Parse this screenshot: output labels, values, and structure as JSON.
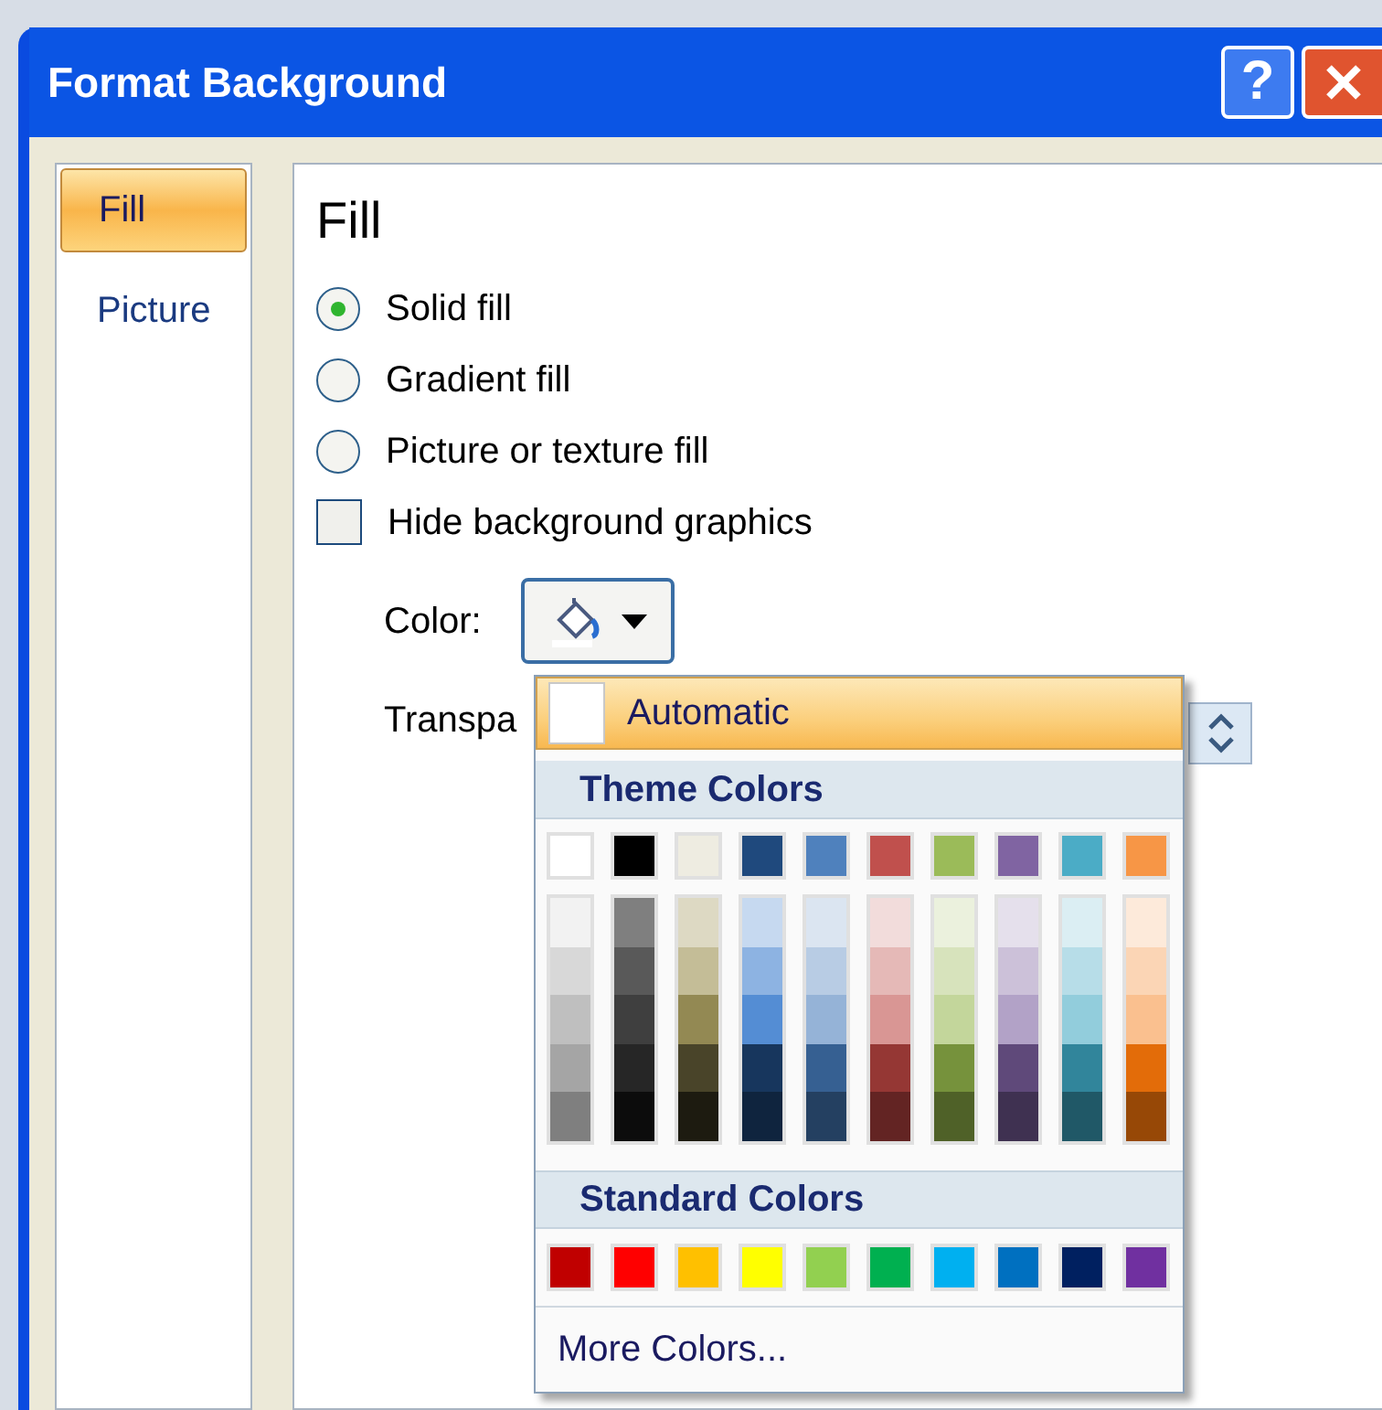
{
  "window": {
    "title": "Format Background",
    "buttons": [
      {
        "kind": "help",
        "label": "?"
      },
      {
        "kind": "close"
      }
    ]
  },
  "sidebar": {
    "items": [
      {
        "label": "Fill",
        "selected": true
      },
      {
        "label": "Picture",
        "selected": false
      }
    ]
  },
  "panel": {
    "heading": "Fill",
    "options": [
      {
        "kind": "radio",
        "label": "Solid fill",
        "checked": true
      },
      {
        "kind": "radio",
        "label": "Gradient fill",
        "checked": false
      },
      {
        "kind": "radio",
        "label": "Picture or texture fill",
        "checked": false
      },
      {
        "kind": "checkbox",
        "label": "Hide background graphics",
        "checked": false
      }
    ],
    "color_label": "Color:",
    "transparency_label": "Transpa"
  },
  "color_menu": {
    "automatic": {
      "label": "Automatic",
      "highlighted": true
    },
    "theme_header": "Theme Colors",
    "theme_colors": [
      {
        "color": "#ffffff",
        "shades": [
          {
            "color": "#f2f2f2"
          },
          {
            "color": "#d8d8d8"
          },
          {
            "color": "#bfbfbf"
          },
          {
            "color": "#a5a5a5"
          },
          {
            "color": "#7f7f7f"
          }
        ]
      },
      {
        "color": "#000000",
        "shades": [
          {
            "color": "#7f7f7f"
          },
          {
            "color": "#595959"
          },
          {
            "color": "#3f3f3f"
          },
          {
            "color": "#262626"
          },
          {
            "color": "#0c0c0c"
          }
        ]
      },
      {
        "color": "#eeece1",
        "shades": [
          {
            "color": "#ddd9c3"
          },
          {
            "color": "#c4bd97"
          },
          {
            "color": "#938953"
          },
          {
            "color": "#494429"
          },
          {
            "color": "#1d1b10"
          }
        ]
      },
      {
        "color": "#1f497d",
        "shades": [
          {
            "color": "#c6d9f0"
          },
          {
            "color": "#8db3e2"
          },
          {
            "color": "#548dd4"
          },
          {
            "color": "#17365d"
          },
          {
            "color": "#0f243e"
          }
        ]
      },
      {
        "color": "#4f81bd",
        "shades": [
          {
            "color": "#dbe5f1"
          },
          {
            "color": "#b8cce4"
          },
          {
            "color": "#95b3d7"
          },
          {
            "color": "#366092"
          },
          {
            "color": "#244061"
          }
        ]
      },
      {
        "color": "#c0504d",
        "shades": [
          {
            "color": "#f2dcdb"
          },
          {
            "color": "#e5b9b7"
          },
          {
            "color": "#d99694"
          },
          {
            "color": "#953734"
          },
          {
            "color": "#632423"
          }
        ]
      },
      {
        "color": "#9bbb59",
        "shades": [
          {
            "color": "#ebf1dd"
          },
          {
            "color": "#d7e3bc"
          },
          {
            "color": "#c3d69b"
          },
          {
            "color": "#76923c"
          },
          {
            "color": "#4f6128"
          }
        ]
      },
      {
        "color": "#8064a2",
        "shades": [
          {
            "color": "#e5e0ec"
          },
          {
            "color": "#ccc1d9"
          },
          {
            "color": "#b2a2c7"
          },
          {
            "color": "#5f497a"
          },
          {
            "color": "#3f3151"
          }
        ]
      },
      {
        "color": "#4bacc6",
        "shades": [
          {
            "color": "#dbeef3"
          },
          {
            "color": "#b7dde8"
          },
          {
            "color": "#92cddc"
          },
          {
            "color": "#31859b"
          },
          {
            "color": "#205867"
          }
        ]
      },
      {
        "color": "#f79646",
        "shades": [
          {
            "color": "#fdeada"
          },
          {
            "color": "#fbd5b5"
          },
          {
            "color": "#fac08f"
          },
          {
            "color": "#e36c09"
          },
          {
            "color": "#974806"
          }
        ]
      }
    ],
    "standard_header": "Standard Colors",
    "standard_colors": [
      {
        "color": "#c00000"
      },
      {
        "color": "#ff0000"
      },
      {
        "color": "#ffc000"
      },
      {
        "color": "#ffff00"
      },
      {
        "color": "#92d050"
      },
      {
        "color": "#00b050"
      },
      {
        "color": "#00b0f0"
      },
      {
        "color": "#0070c0"
      },
      {
        "color": "#002060"
      },
      {
        "color": "#7030a0"
      }
    ],
    "more_label": "More Colors..."
  }
}
